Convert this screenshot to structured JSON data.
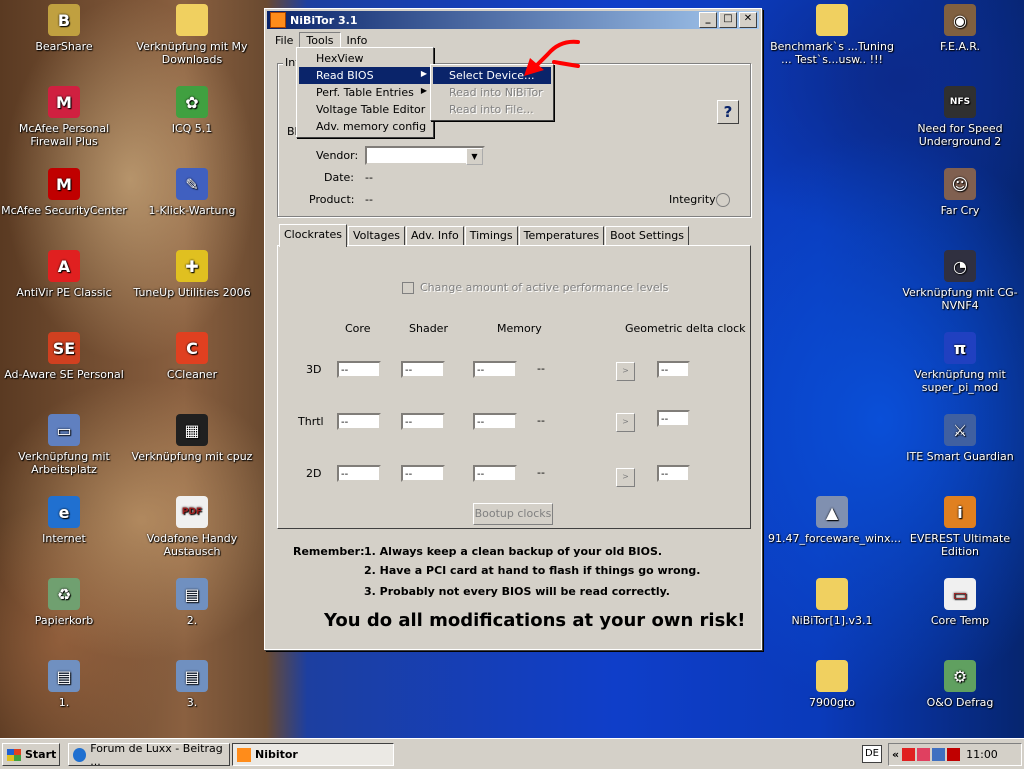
{
  "desktop": {
    "icons_left": [
      {
        "label": "BearShare",
        "icon": "bearshare-icon",
        "color": "#c0a040",
        "glyph": "B"
      },
      {
        "label": "McAfee Personal Firewall Plus",
        "icon": "firewall-icon",
        "color": "#d02040",
        "glyph": "M"
      },
      {
        "label": "McAfee SecurityCenter",
        "icon": "mcafee-icon",
        "color": "#c00000",
        "glyph": "M"
      },
      {
        "label": "AntiVir PE Classic",
        "icon": "antivir-icon",
        "color": "#e02020",
        "glyph": "A"
      },
      {
        "label": "Ad-Aware SE Personal",
        "icon": "adaware-icon",
        "color": "#d04020",
        "glyph": "SE"
      },
      {
        "label": "Verknüpfung mit Arbeitsplatz",
        "icon": "computer-icon",
        "color": "#6080c0",
        "glyph": "▭"
      },
      {
        "label": "Internet",
        "icon": "internet-explorer-icon",
        "color": "#2070d0",
        "glyph": "e"
      },
      {
        "label": "Papierkorb",
        "icon": "recycle-bin-icon",
        "color": "#70a070",
        "glyph": "♻"
      },
      {
        "label": "1.",
        "icon": "document-icon",
        "color": "#7090c0",
        "glyph": "▤"
      }
    ],
    "icons_mid": [
      {
        "label": "Verknüpfung mit My Downloads",
        "icon": "folder-icon",
        "color": "#f0d060",
        "glyph": ""
      },
      {
        "label": "ICQ 5.1",
        "icon": "icq-icon",
        "color": "#40a040",
        "glyph": "✿"
      },
      {
        "label": "1-Klick-Wartung",
        "icon": "wartung-icon",
        "color": "#4060c0",
        "glyph": "✎"
      },
      {
        "label": "TuneUp Utilities 2006",
        "icon": "tuneup-icon",
        "color": "#e0c020",
        "glyph": "✚"
      },
      {
        "label": "CCleaner",
        "icon": "ccleaner-icon",
        "color": "#e04020",
        "glyph": "C"
      },
      {
        "label": "Verknüpfung mit cpuz",
        "icon": "cpu-icon",
        "color": "#202020",
        "glyph": "▦"
      },
      {
        "label": "Vodafone Handy Austausch",
        "icon": "pdf-icon",
        "color": "#f0f0f0",
        "glyph": "PDF"
      },
      {
        "label": "2.",
        "icon": "document-icon",
        "color": "#7090c0",
        "glyph": "▤"
      },
      {
        "label": "3.",
        "icon": "document-icon",
        "color": "#7090c0",
        "glyph": "▤"
      }
    ],
    "icons_right2": [
      {
        "label": "Benchmark`s ...Tuning ... Test`s...usw.. !!!",
        "icon": "folder-icon",
        "color": "#f0d060",
        "glyph": ""
      },
      {
        "label": "91.47_forceware_winx...",
        "icon": "installer-icon",
        "color": "#8090b0",
        "glyph": "▲"
      },
      {
        "label": "NiBiTor[1].v3.1",
        "icon": "folder-icon",
        "color": "#f0d060",
        "glyph": ""
      },
      {
        "label": "7900gto",
        "icon": "folder-icon",
        "color": "#f0d060",
        "glyph": ""
      }
    ],
    "icons_right": [
      {
        "label": "F.E.A.R.",
        "icon": "fear-icon",
        "color": "#806040",
        "glyph": "◉"
      },
      {
        "label": "Need for Speed Underground 2",
        "icon": "nfs-icon",
        "color": "#303030",
        "glyph": "NFS"
      },
      {
        "label": "Far Cry",
        "icon": "farcry-icon",
        "color": "#806050",
        "glyph": "☺"
      },
      {
        "label": "Verknüpfung mit CG-NVNF4",
        "icon": "gauge-icon",
        "color": "#303040",
        "glyph": "◔"
      },
      {
        "label": "Verknüpfung mit super_pi_mod",
        "icon": "superpi-icon",
        "color": "#2040c0",
        "glyph": "π"
      },
      {
        "label": "ITE Smart Guardian",
        "icon": "guardian-icon",
        "color": "#4060a0",
        "glyph": "⚔"
      },
      {
        "label": "EVEREST Ultimate Edition",
        "icon": "everest-icon",
        "color": "#e08020",
        "glyph": "i"
      },
      {
        "label": "Core Temp",
        "icon": "coretemp-icon",
        "color": "#f0f0f0",
        "glyph": "▭"
      },
      {
        "label": "O&O Defrag",
        "icon": "defrag-icon",
        "color": "#60a060",
        "glyph": "⚙"
      }
    ]
  },
  "window": {
    "title": "NiBiTor 3.1",
    "menu": [
      "File",
      "Tools",
      "Info"
    ],
    "info_group_label": "Inf",
    "bios_label": "Bl",
    "vendor_label": "Vendor:",
    "date_label": "Date:",
    "date_value": "--",
    "product_label": "Product:",
    "product_value": "--",
    "integrity_label": "Integrity :",
    "help_label": "?",
    "tabs": [
      "Clockrates",
      "Voltages",
      "Adv. Info",
      "Timings",
      "Temperatures",
      "Boot Settings"
    ],
    "checkbox_label": "Change amount of active performance levels",
    "columns": [
      "Core",
      "Shader",
      "Memory",
      "Geometric delta clock"
    ],
    "rows": [
      {
        "label": "3D",
        "core": "--",
        "shader": "--",
        "memory": "--",
        "extra": "--",
        "delta": "--"
      },
      {
        "label": "Thrtl",
        "core": "--",
        "shader": "--",
        "memory": "--",
        "extra": "--",
        "delta": "--"
      },
      {
        "label": "2D",
        "core": "--",
        "shader": "--",
        "memory": "--",
        "extra": "--",
        "delta": "--"
      }
    ],
    "row_button": ">",
    "bootup_button": "Bootup clocks",
    "remember_label": "Remember:",
    "remember_items": [
      "1. Always keep a clean backup of your old BIOS.",
      "2. Have a PCI card at hand to flash if things go wrong.",
      "3. Probably not every BIOS will be read correctly."
    ],
    "warning": "You do all modifications at your own risk!"
  },
  "tools_menu": {
    "items": [
      "HexView",
      "Read BIOS",
      "Perf. Table Entries",
      "Voltage Table Editor",
      "Adv. memory config"
    ],
    "submenu_arrow": "▶"
  },
  "read_bios_submenu": {
    "items": [
      "Select Device...",
      "Read into NiBiTor",
      "Read into File..."
    ]
  },
  "taskbar": {
    "start": "Start",
    "tasks": [
      "Forum de Luxx - Beitrag ...",
      "Nibitor"
    ],
    "language": "DE",
    "tray_chevron": "«",
    "clock": "11:00"
  },
  "colors": {
    "title_active": "#0a246a",
    "annotation_arrow": "#ff0000",
    "face": "#d4d0c8"
  }
}
